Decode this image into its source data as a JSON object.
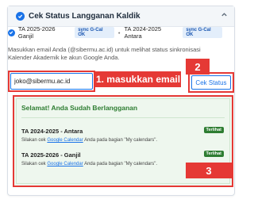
{
  "panel": {
    "title": "Cek Status Langganan Kaldik"
  },
  "status": {
    "items": [
      {
        "label": "TA 2025-2026 Ganjil",
        "badge": "sync G-Cal OK"
      },
      {
        "label": "TA 2024-2025 Antara",
        "badge": "sync G-Cal OK"
      }
    ],
    "separator": "•"
  },
  "description": "Masukkan email Anda (@sibermu.ac.id) untuk melihat status sinkronisasi Kalender Akademik ke akun Google Anda.",
  "email_input": {
    "value": "joko@sibermu.ac.id"
  },
  "check_button_label": "Cek Status",
  "annotations": {
    "step1": "1. masukkan email",
    "step2": "2",
    "step3": "3"
  },
  "result": {
    "title": "Selamat! Anda Sudah Berlangganan",
    "items": [
      {
        "name": "TA 2024-2025 - Antara",
        "status": "Terlihat",
        "note_prefix": "Silakan cek",
        "note_link": "Google Calendar",
        "note_suffix": "Anda pada bagian \"My calendars\"."
      },
      {
        "name": "TA 2025-2026 - Ganjil",
        "status": "Terlihat",
        "note_prefix": "Silakan cek",
        "note_link": "Google Calendar",
        "note_suffix": "Anda pada bagian \"My calendars\"."
      }
    ]
  },
  "colors": {
    "accent": "#1a73e8",
    "highlight": "#e53935",
    "success": "#2e7d32"
  }
}
